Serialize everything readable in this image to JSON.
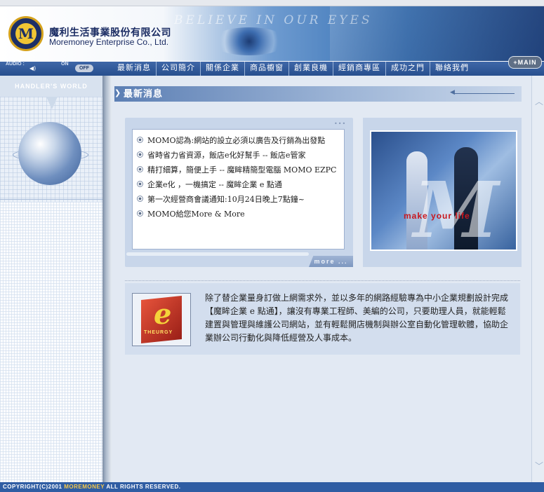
{
  "header": {
    "logo_letter": "M",
    "company_name_cn": "魔利生活事業股份有限公司",
    "company_name_en": "Moremoney Enterprise Co., Ltd.",
    "slogan": "BELIEVE IN OUR EYES",
    "main_button": "+MAIN"
  },
  "audio": {
    "label": "AUDIO :",
    "on": "ON",
    "off": "OFF"
  },
  "nav": {
    "items": [
      "最新消息",
      "公司簡介",
      "關係企業",
      "商品櫥窗",
      "創業良機",
      "經銷商專區",
      "成功之門",
      "聯絡我們"
    ]
  },
  "sidebar": {
    "title": "HANDLER'S WORLD"
  },
  "news": {
    "section_title": "最新消息",
    "items": [
      "MOMO認為:網站的設立必須以廣告及行銷為出發點",
      "省時省力省資源，飯店e化好幫手 -- 飯店e管家",
      "精打細算，簡便上手 -- 魔眸精簡型電腦 MOMO EZPC",
      "企業e化 ，一機搞定 -- 魔眸企業 e 點通",
      "第一次經營商會議通知:10月24日晚上7點鐘~",
      "MOMO給您More & More"
    ],
    "more_label": "more ..."
  },
  "photo": {
    "slogan": "make your life"
  },
  "product": {
    "label": "THEURGY",
    "letter": "e",
    "description": "除了替企業量身訂做上網需求外，並以多年的網路經驗專為中小企業規劃設計完成【魔眸企業 e 點通】，讓沒有專業工程師、美編的公司，只要助理人員，就能輕鬆建置與管理與維護公司網站，並有輕鬆開店機制與辦公室自動化管理軟體，協助企業辦公司行動化與降低經營及人事成本。"
  },
  "footer": {
    "copyright_prefix": "COPYRIGHT(C)2001",
    "brand": "MOREMONEY",
    "copyright_suffix": "ALL RIGHTS RESERVED."
  }
}
